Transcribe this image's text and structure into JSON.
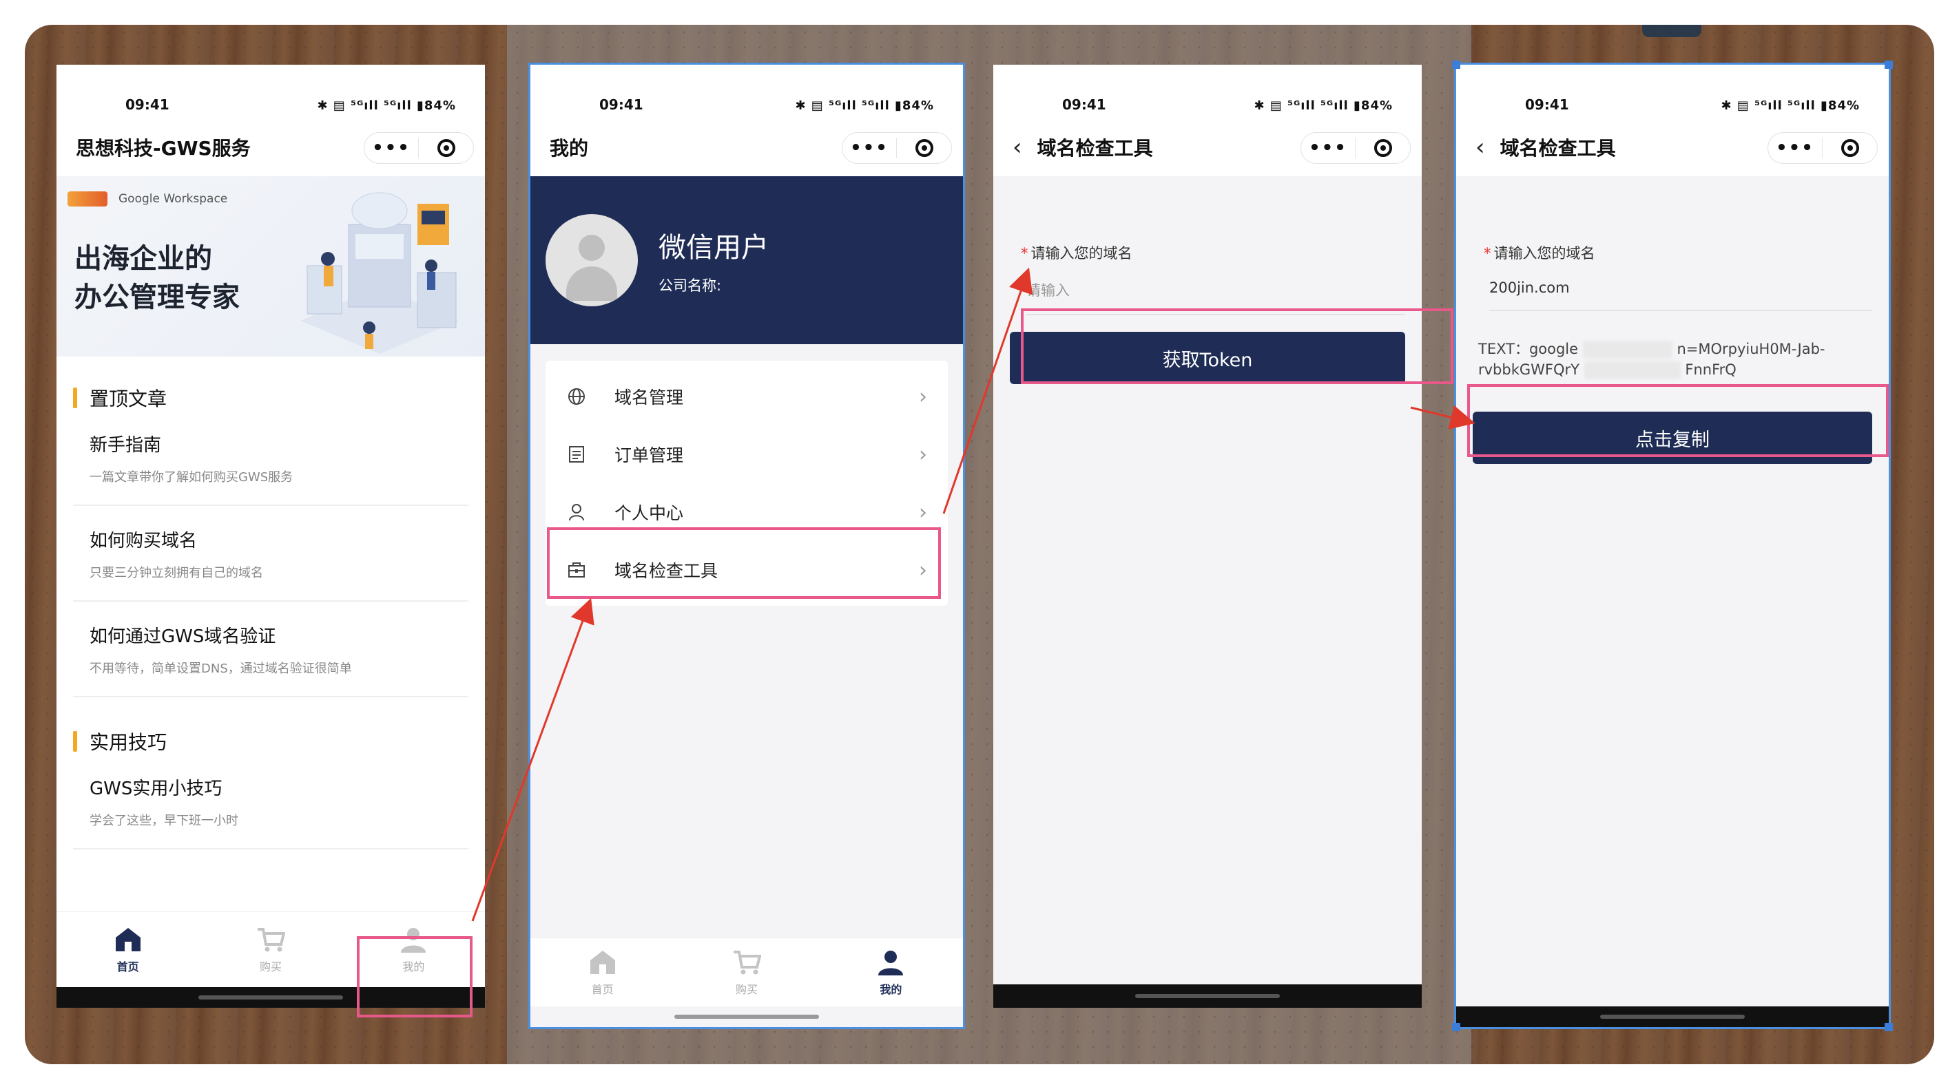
{
  "status": {
    "time": "09:41",
    "icons": "✱ ▤ ⁵ᴳıll ⁵ᴳıll ▮84%"
  },
  "phone1": {
    "title": "思想科技-GWS服务",
    "brand": "Google Workspace",
    "headline_line1": "出海企业的",
    "headline_line2": "办公管理专家",
    "section1": "置顶文章",
    "articles1": [
      {
        "title": "新手指南",
        "sub": "一篇文章带你了解如何购买GWS服务"
      },
      {
        "title": "如何购买域名",
        "sub": "只要三分钟立刻拥有自己的域名"
      },
      {
        "title": "如何通过GWS域名验证",
        "sub": "不用等待，简单设置DNS，通过域名验证很简单"
      }
    ],
    "section2": "实用技巧",
    "articles2": [
      {
        "title": "GWS实用小技巧",
        "sub": "学会了这些，早下班一小时"
      }
    ],
    "tabs": [
      "首页",
      "购买",
      "我的"
    ]
  },
  "phone2": {
    "title": "我的",
    "user_name": "微信用户",
    "company": "公司名称:",
    "menu": [
      "域名管理",
      "订单管理",
      "个人中心",
      "域名检查工具"
    ],
    "tabs": [
      "首页",
      "购买",
      "我的"
    ]
  },
  "phone3": {
    "title": "域名检查工具",
    "label": "请输入您的域名",
    "placeholder": "请输入",
    "button": "获取Token"
  },
  "phone4": {
    "title": "域名检查工具",
    "label": "请输入您的域名",
    "value": "200jin.com",
    "token_prefix": "TEXT：google",
    "token_mid": "n=MOrpyiuH0M-Jab-",
    "token_line2a": "rvbbkGWFQrY",
    "token_line2b": "FnnFrQ",
    "button": "点击复制"
  },
  "colors": {
    "primary": "#1f2d56",
    "accent": "#f5a623",
    "highlight": "#e8588a",
    "arrow": "#e0392b"
  }
}
